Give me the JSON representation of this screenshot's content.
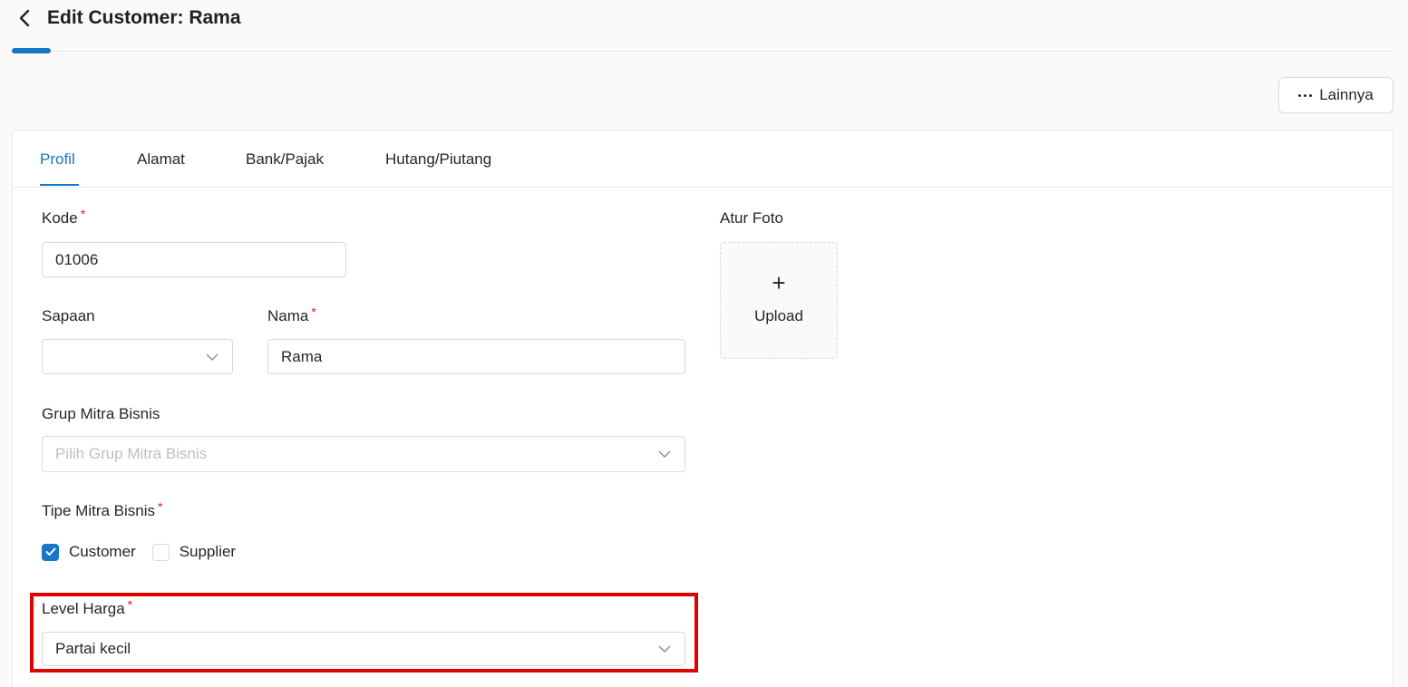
{
  "header": {
    "title": "Edit Customer: Rama",
    "more_label": "Lainnya"
  },
  "tabs": [
    {
      "label": "Profil",
      "active": true
    },
    {
      "label": "Alamat",
      "active": false
    },
    {
      "label": "Bank/Pajak",
      "active": false
    },
    {
      "label": "Hutang/Piutang",
      "active": false
    }
  ],
  "form": {
    "kode": {
      "label": "Kode",
      "required_mark": "*",
      "value": "01006"
    },
    "sapaan": {
      "label": "Sapaan",
      "value": ""
    },
    "nama": {
      "label": "Nama",
      "required_mark": "*",
      "value": "Rama"
    },
    "grup": {
      "label": "Grup Mitra Bisnis",
      "placeholder": "Pilih Grup Mitra Bisnis"
    },
    "tipe": {
      "label": "Tipe Mitra Bisnis",
      "required_mark": "*",
      "options": [
        {
          "label": "Customer",
          "checked": true
        },
        {
          "label": "Supplier",
          "checked": false
        }
      ]
    },
    "level_harga": {
      "label": "Level Harga",
      "required_mark": "*",
      "value": "Partai kecil"
    }
  },
  "photo": {
    "label": "Atur Foto",
    "upload_label": "Upload",
    "plus_icon": "+"
  },
  "colors": {
    "accent": "#1677c8",
    "required": "#e02020",
    "highlight": "#e00000"
  }
}
